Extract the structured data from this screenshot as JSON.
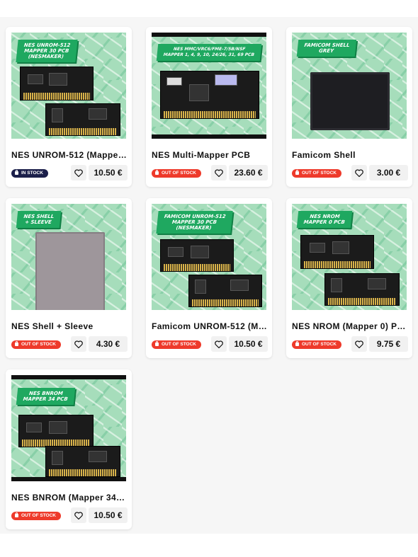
{
  "products": [
    {
      "name": "NES UNROM-512 (Mapper ...",
      "tag": "NES UNROM-512\nMAPPER 30 PCB\n(NESMAKER)",
      "stock": "IN STOCK",
      "price": "10.50 €"
    },
    {
      "name": "NES Multi-Mapper PCB",
      "tag": "NES MMC/VRC6/FME-7/5B/NSF\nMAPPER 1, 4, 9, 10, 24/26, 31, 69 PCB",
      "stock": "OUT OF STOCK",
      "price": "23.60 €"
    },
    {
      "name": "Famicom Shell",
      "tag": "FAMICOM SHELL\nGREY",
      "stock": "OUT OF STOCK",
      "price": "3.00 €"
    },
    {
      "name": "NES Shell + Sleeve",
      "tag": "NES SHELL\n+ SLEEVE",
      "stock": "OUT OF STOCK",
      "price": "4.30 €"
    },
    {
      "name": "Famicom UNROM-512 (Ma...",
      "tag": "FAMICOM UNROM-512\nMAPPER 30 PCB\n(NESMAKER)",
      "stock": "OUT OF STOCK",
      "price": "10.50 €"
    },
    {
      "name": "NES NROM (Mapper 0) PCB",
      "tag": "NES NROM\nMAPPER 0 PCB",
      "stock": "OUT OF STOCK",
      "price": "9.75 €"
    },
    {
      "name": "NES BNROM (Mapper 34) ...",
      "tag": "NES BNROM\nMAPPER 34 PCB",
      "stock": "OUT OF STOCK",
      "price": "10.50 €"
    }
  ],
  "colors": {
    "in_stock": "#1b1f4a",
    "out_of_stock": "#ee3a2b",
    "tag": "#1fa860",
    "image_bg": "#a6ddbb"
  },
  "icons": {
    "favorite": "heart-outline-icon",
    "stock": "lock-icon"
  }
}
